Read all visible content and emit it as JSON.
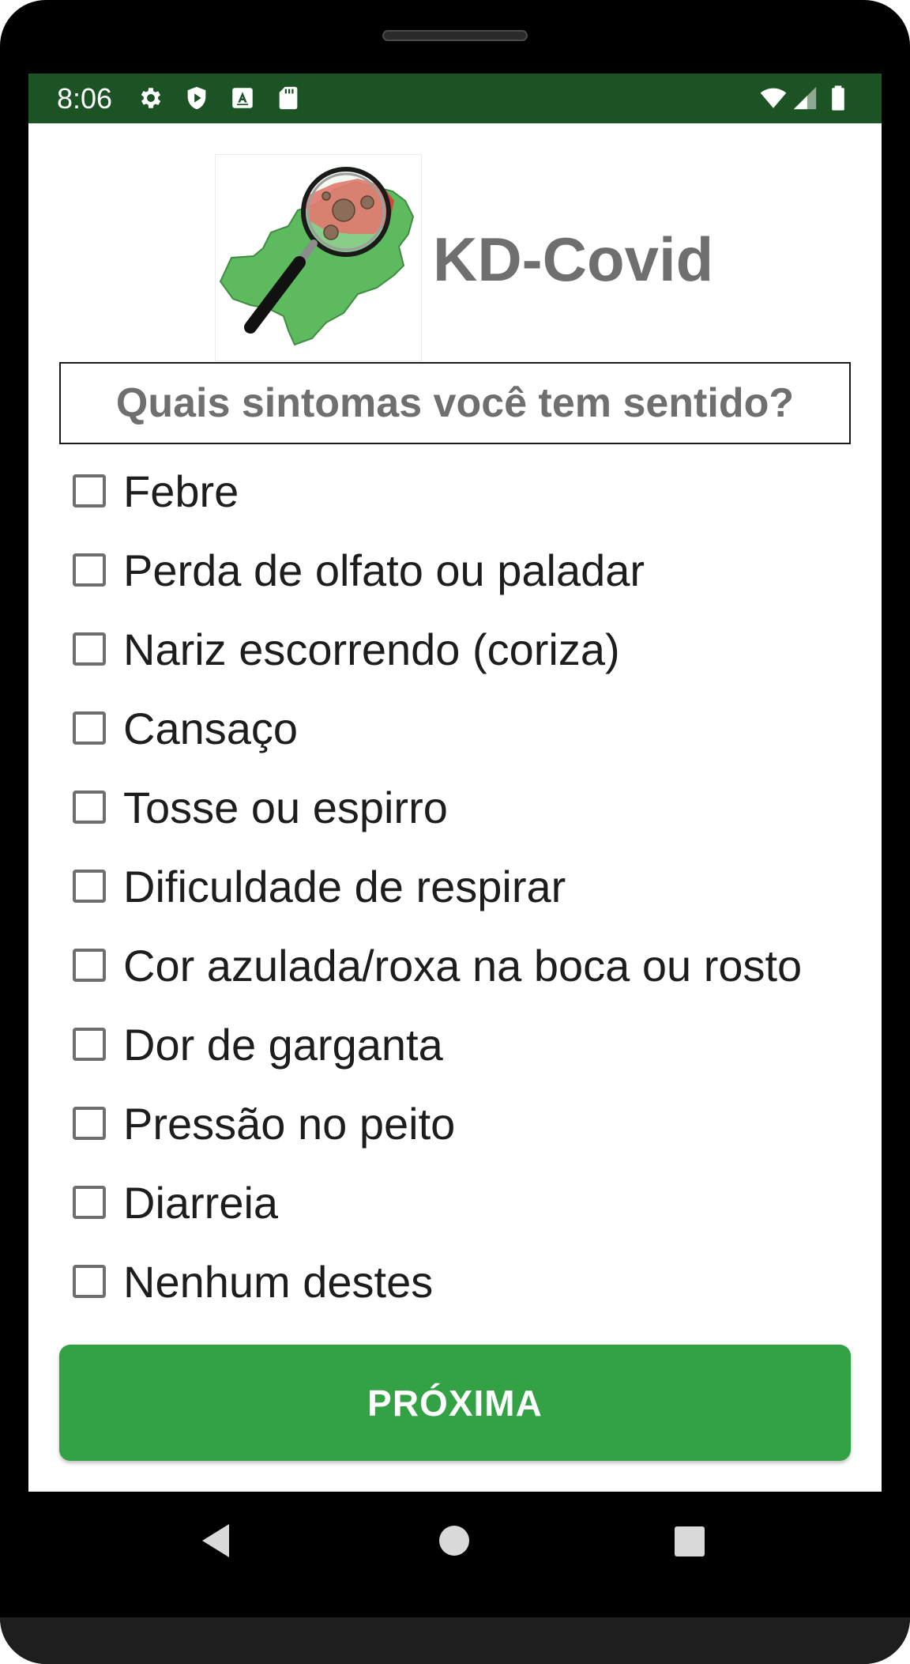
{
  "status_bar": {
    "time": "8:06",
    "icons": [
      "gear-icon",
      "shield-play-icon",
      "text-a-icon",
      "sd-card-icon",
      "wifi-icon",
      "cellular-signal-icon",
      "battery-icon"
    ],
    "background": "#1b5325"
  },
  "header": {
    "app_title": "KD-Covid",
    "logo": "magnifier-over-map-logo"
  },
  "question": {
    "text": "Quais sintomas você tem sentido?"
  },
  "symptoms": [
    {
      "label": "Febre",
      "checked": false
    },
    {
      "label": "Perda de olfato ou paladar",
      "checked": false
    },
    {
      "label": "Nariz escorrendo (coriza)",
      "checked": false
    },
    {
      "label": "Cansaço",
      "checked": false
    },
    {
      "label": "Tosse ou espirro",
      "checked": false
    },
    {
      "label": "Dificuldade de respirar",
      "checked": false
    },
    {
      "label": "Cor azulada/roxa na boca ou rosto",
      "checked": false
    },
    {
      "label": "Dor de garganta",
      "checked": false
    },
    {
      "label": "Pressão no peito",
      "checked": false
    },
    {
      "label": "Diarreia",
      "checked": false
    },
    {
      "label": "Nenhum destes",
      "checked": false
    }
  ],
  "actions": {
    "next_label": "PRÓXIMA",
    "button_color": "#32a245"
  },
  "nav_bar": {
    "icons": [
      "back-triangle-icon",
      "home-circle-icon",
      "recents-square-icon"
    ]
  }
}
